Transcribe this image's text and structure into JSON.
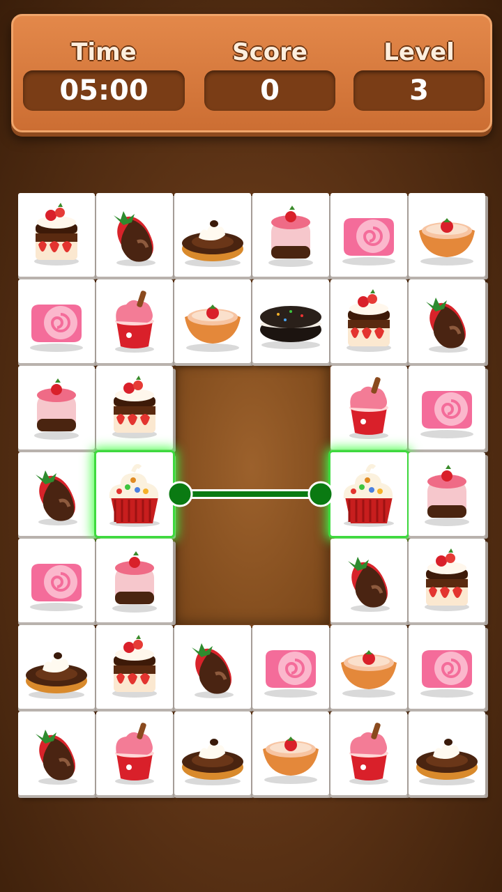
{
  "hud": {
    "time_label": "Time",
    "time_value": "05:00",
    "score_label": "Score",
    "score_value": "0",
    "level_label": "Level",
    "level_value": "3"
  },
  "board": {
    "rows": [
      [
        "strawberry-shortcake",
        "chocolate-strawberry",
        "cream-donut",
        "pink-mousse-cake",
        "swiss-roll",
        "strawberry-tart"
      ],
      [
        "swiss-roll",
        "strawberry-sundae-cup",
        "strawberry-tart",
        "sprinkle-cookie",
        "strawberry-shortcake",
        "chocolate-strawberry"
      ],
      [
        "pink-mousse-cake",
        "strawberry-shortcake",
        null,
        null,
        "strawberry-sundae-cup",
        "swiss-roll"
      ],
      [
        "chocolate-strawberry",
        "candy-cupcake",
        null,
        null,
        "candy-cupcake",
        "pink-mousse-cake"
      ],
      [
        "swiss-roll",
        "pink-mousse-cake",
        null,
        null,
        "chocolate-strawberry",
        "strawberry-shortcake"
      ],
      [
        "cream-donut",
        "strawberry-shortcake",
        "chocolate-strawberry",
        "swiss-roll",
        "strawberry-tart",
        "swiss-roll"
      ],
      [
        "chocolate-strawberry",
        "strawberry-sundae-cup",
        "cream-donut",
        "strawberry-tart",
        "strawberry-sundae-cup",
        "cream-donut"
      ]
    ],
    "selected": [
      [
        3,
        1
      ],
      [
        3,
        4
      ]
    ],
    "connector_color": "#0a7a12",
    "highlight_color": "#3ed93e"
  }
}
